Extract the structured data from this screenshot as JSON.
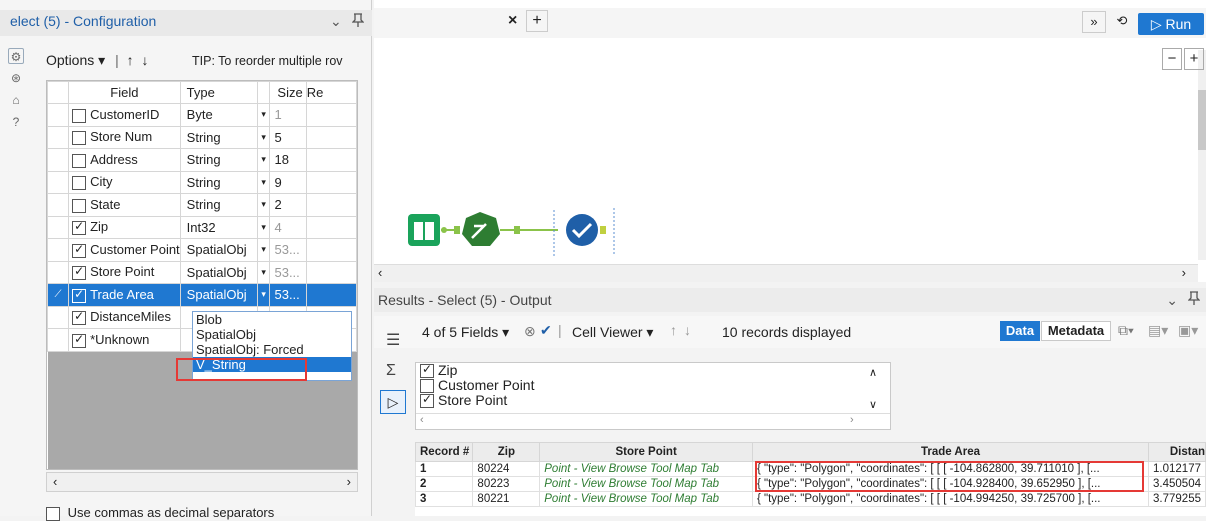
{
  "left_panel": {
    "title": "elect (5) - Configuration",
    "title_icon_pin": "pin-icon",
    "options_label": "Options",
    "tip": "TIP: To reorder multiple rov",
    "columns": [
      "Field",
      "Type",
      "Size",
      "Re"
    ],
    "rows": [
      {
        "checked": false,
        "field": "CustomerID",
        "type": "Byte",
        "size": "1",
        "size_dim": true
      },
      {
        "checked": false,
        "field": "Store Num",
        "type": "String",
        "size": "5",
        "size_dim": false
      },
      {
        "checked": false,
        "field": "Address",
        "type": "String",
        "size": "18",
        "size_dim": false
      },
      {
        "checked": false,
        "field": "City",
        "type": "String",
        "size": "9",
        "size_dim": false
      },
      {
        "checked": false,
        "field": "State",
        "type": "String",
        "size": "2",
        "size_dim": false
      },
      {
        "checked": true,
        "field": "Zip",
        "type": "Int32",
        "size": "4",
        "size_dim": true
      },
      {
        "checked": true,
        "field": "Customer Point",
        "type": "SpatialObj",
        "size": "53...",
        "size_dim": true
      },
      {
        "checked": true,
        "field": "Store Point",
        "type": "SpatialObj",
        "size": "53...",
        "size_dim": true
      },
      {
        "checked": true,
        "field": "Trade Area",
        "type": "SpatialObj",
        "size": "53...",
        "size_dim": false,
        "selected": true
      },
      {
        "checked": true,
        "field": "DistanceMiles",
        "type": "",
        "size": "",
        "size_dim": false
      },
      {
        "checked": true,
        "field": "*Unknown",
        "type": "",
        "size": "",
        "size_dim": false
      }
    ],
    "dropdown_options": [
      "Blob",
      "SpatialObj",
      "SpatialObj: Forced",
      "V_String"
    ],
    "dropdown_highlighted": "V_String",
    "commas_label": "Use commas as decimal separators"
  },
  "canvas": {
    "tab_close": "×",
    "tab_add": "+",
    "more": "»",
    "run_label": "▷ Run",
    "zoom_out": "−",
    "zoom_in": "+",
    "tools": [
      "input-book-icon",
      "formula-icon",
      "select-check-icon"
    ]
  },
  "results": {
    "title": "Results - Select (5) - Output",
    "fields_label": "4 of 5 Fields",
    "cell_viewer_label": "Cell Viewer",
    "records_label": "10 records displayed",
    "data_label": "Data",
    "metadata_label": "Metadata",
    "field_list": [
      {
        "checked": true,
        "name": "Zip"
      },
      {
        "checked": false,
        "name": "Customer Point"
      },
      {
        "checked": true,
        "name": "Store Point"
      }
    ],
    "columns": [
      "Record #",
      "Zip",
      "Store Point",
      "Trade Area",
      "Distan"
    ],
    "rows": [
      {
        "rec": "1",
        "zip": "80224",
        "store": "Point - View Browse Tool Map Tab",
        "trade": "{ \"type\": \"Polygon\", \"coordinates\": [ [ [ -104.862800, 39.711010 ], [...",
        "dist": "1.012177"
      },
      {
        "rec": "2",
        "zip": "80223",
        "store": "Point - View Browse Tool Map Tab",
        "trade": "{ \"type\": \"Polygon\", \"coordinates\": [ [ [ -104.928400, 39.652950 ], [...",
        "dist": "3.450504"
      },
      {
        "rec": "3",
        "zip": "80221",
        "store": "Point - View Browse Tool Map Tab",
        "trade": "{ \"type\": \"Polygon\", \"coordinates\": [ [ [ -104.994250, 39.725700 ], [...",
        "dist": "3.779255"
      }
    ]
  },
  "colors": {
    "accent": "#1f78d1",
    "highlight_red": "#e53935",
    "link_green": "#2e7d32"
  }
}
